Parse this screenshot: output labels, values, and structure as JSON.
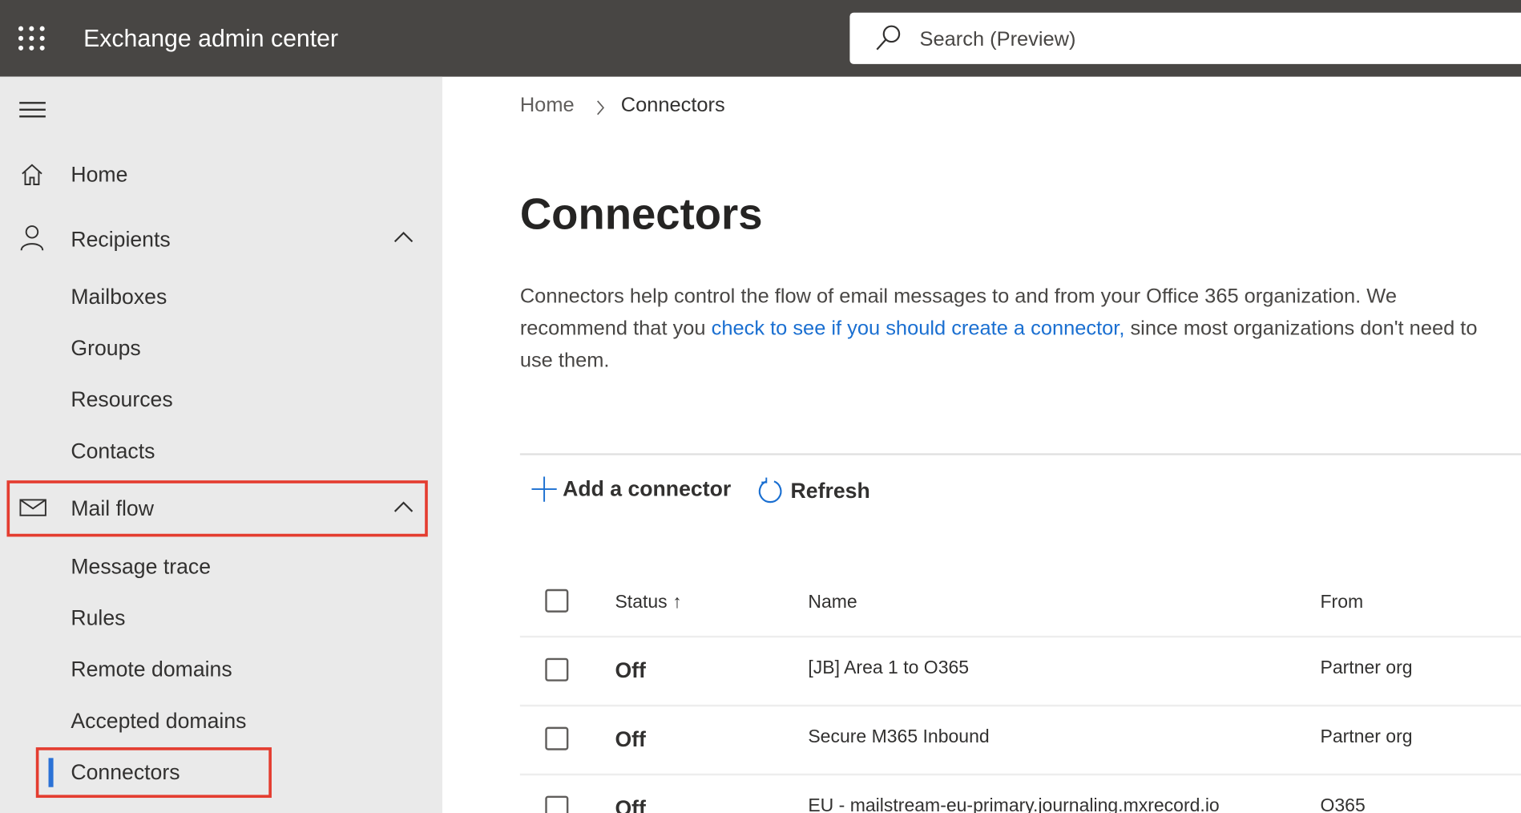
{
  "header": {
    "app_title": "Exchange admin center",
    "search_placeholder": "Search (Preview)"
  },
  "sidebar": {
    "home": "Home",
    "recipients": {
      "label": "Recipients",
      "items": [
        "Mailboxes",
        "Groups",
        "Resources",
        "Contacts"
      ]
    },
    "mail_flow": {
      "label": "Mail flow",
      "items": [
        "Message trace",
        "Rules",
        "Remote domains",
        "Accepted domains",
        "Connectors"
      ]
    }
  },
  "breadcrumb": {
    "home": "Home",
    "current": "Connectors"
  },
  "page": {
    "title": "Connectors",
    "desc_before": "Connectors help control the flow of email messages to and from your Office 365 organization. We recommend that you ",
    "desc_link": "check to see if you should create a connector,",
    "desc_after": " since most organizations don't need to use them."
  },
  "toolbar": {
    "add": "Add a connector",
    "refresh": "Refresh"
  },
  "table": {
    "columns": [
      "Status",
      "Name",
      "From"
    ],
    "rows": [
      {
        "status": "Off",
        "name": "[JB] Area 1 to O365",
        "from": "Partner org"
      },
      {
        "status": "Off",
        "name": "Secure M365 Inbound",
        "from": "Partner org"
      },
      {
        "status": "Off",
        "name": "EU - mailstream-eu-primary.journaling.mxrecord.io",
        "from": "O365"
      }
    ]
  }
}
